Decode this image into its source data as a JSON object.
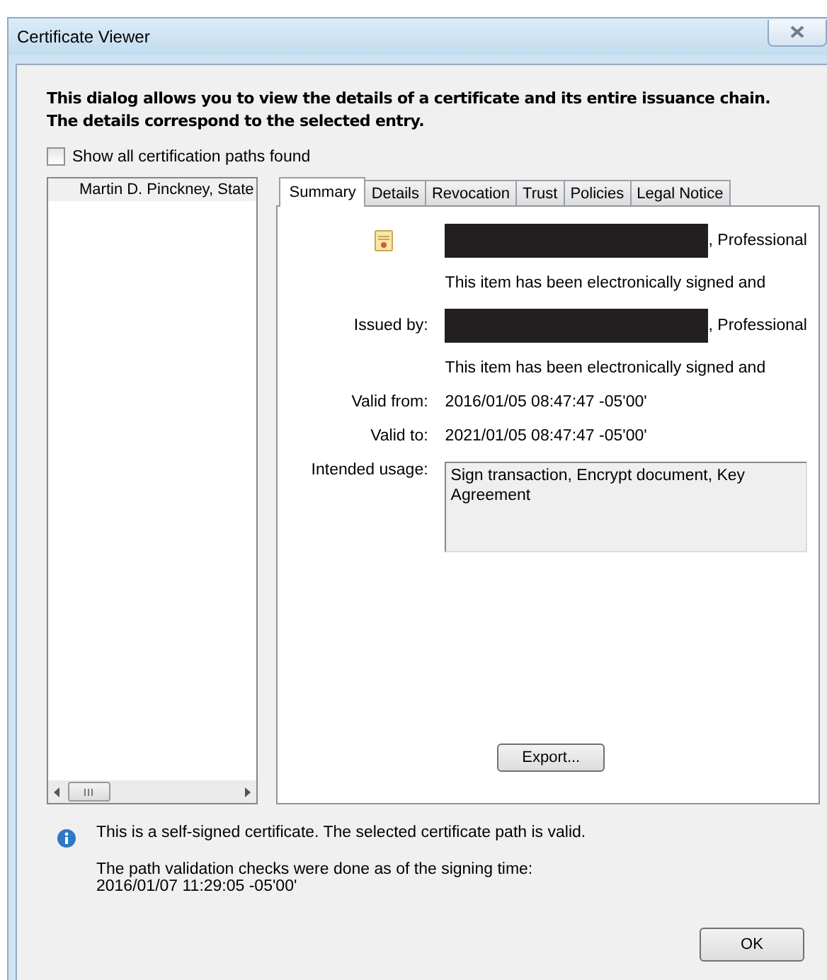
{
  "window": {
    "title": "Certificate Viewer"
  },
  "intro": "This dialog allows you to view the details of a certificate and its entire issuance chain. The details correspond to the selected entry.",
  "show_all_paths": {
    "label": "Show all certification paths found",
    "checked": false
  },
  "chain": [
    {
      "label": "Martin D. Pinckney, State",
      "selected": true
    }
  ],
  "tabs": [
    {
      "label": "Summary",
      "selected": true
    },
    {
      "label": "Details",
      "selected": false
    },
    {
      "label": "Revocation",
      "selected": false
    },
    {
      "label": "Trust",
      "selected": false
    },
    {
      "label": "Policies",
      "selected": false
    },
    {
      "label": "Legal Notice",
      "selected": false
    }
  ],
  "summary": {
    "subject": {
      "text": ", Professional",
      "redacted": true,
      "note": "This item has been electronically signed and"
    },
    "issued_by": {
      "label": "Issued by:",
      "text": ", Professional",
      "redacted": true,
      "note": "This item has been electronically signed and"
    },
    "valid_from": {
      "label": "Valid from:",
      "value": "2016/01/05 08:47:47 -05'00'"
    },
    "valid_to": {
      "label": "Valid to:",
      "value": "2021/01/05 08:47:47 -05'00'"
    },
    "intended_usage": {
      "label": "Intended usage:",
      "value": "Sign transaction, Encrypt document, Key Agreement"
    },
    "export_button": "Export..."
  },
  "status": {
    "message": "This is a self-signed certificate. The selected certificate path is valid.",
    "validation_note": "The path validation checks were done as of the signing time:",
    "validation_time": "2016/01/07 11:29:05 -05'00'"
  },
  "buttons": [
    "OK"
  ]
}
